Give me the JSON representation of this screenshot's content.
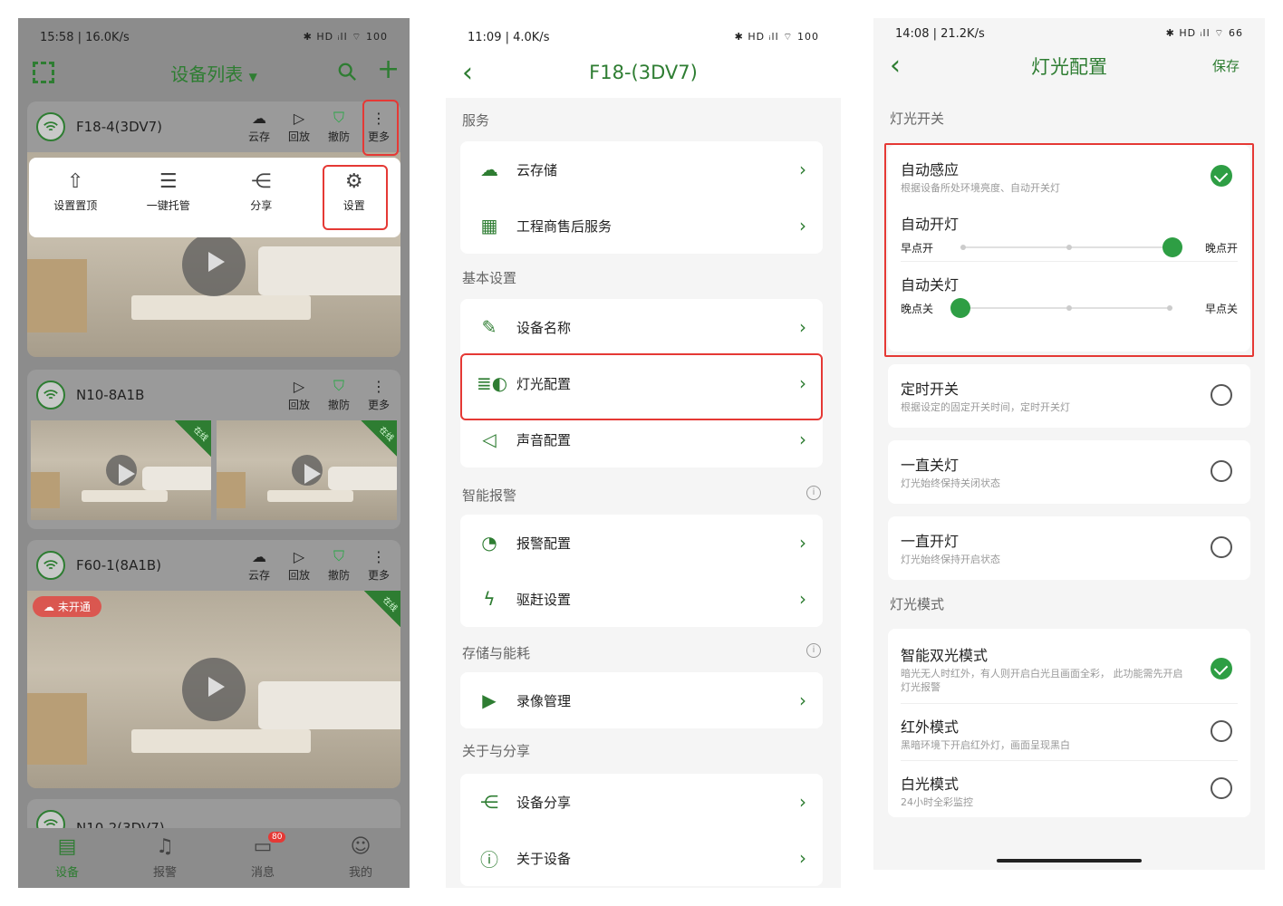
{
  "screen1": {
    "status": {
      "time": "15:58 | 16.0K/s",
      "right": "✱ HD ᵢll ⌔ 100"
    },
    "title": "设备列表",
    "devices": [
      {
        "name": "F18-4(3DV7)",
        "actions": [
          "云存",
          "回放",
          "撤防",
          "更多"
        ]
      },
      {
        "name": "N10-8A1B",
        "actions": [
          "回放",
          "撤防",
          "更多"
        ],
        "online": "在线"
      },
      {
        "name": "F60-1(8A1B)",
        "actions": [
          "云存",
          "回放",
          "撤防",
          "更多"
        ],
        "online": "在线",
        "cloud_pill": "未开通"
      },
      {
        "name": "N10-2(3DV7)"
      }
    ],
    "popup": [
      "设置置顶",
      "一键托管",
      "分享",
      "设置"
    ],
    "tabs": [
      {
        "label": "设备",
        "icon": "device-icon"
      },
      {
        "label": "报警",
        "icon": "bell-icon"
      },
      {
        "label": "消息",
        "icon": "message-icon",
        "badge": "80"
      },
      {
        "label": "我的",
        "icon": "user-icon"
      }
    ]
  },
  "screen2": {
    "status": {
      "time": "11:09 | 4.0K/s",
      "right": "✱ HD ᵢll ⌔ 100"
    },
    "title": "F18-(3DV7)",
    "sections": [
      {
        "label": "服务",
        "items": [
          "云存储",
          "工程商售后服务"
        ]
      },
      {
        "label": "基本设置",
        "items": [
          "设备名称",
          "灯光配置",
          "声音配置"
        ]
      },
      {
        "label": "智能报警",
        "items": [
          "报警配置",
          "驱赶设置"
        ]
      },
      {
        "label": "存储与能耗",
        "items": [
          "录像管理"
        ]
      },
      {
        "label": "关于与分享",
        "items": [
          "设备分享",
          "关于设备"
        ]
      }
    ]
  },
  "screen3": {
    "status": {
      "time": "14:08 | 21.2K/s",
      "right": "✱ HD ᵢll ⌔ 66"
    },
    "title": "灯光配置",
    "save": "保存",
    "section_switch": "灯光开关",
    "auto": {
      "title": "自动感应",
      "desc": "根据设备所处环境亮度、自动开关灯",
      "on_title": "自动开灯",
      "on_left": "早点开",
      "on_right": "晚点开",
      "on_level": 1.0,
      "off_title": "自动关灯",
      "off_left": "晚点关",
      "off_right": "早点关",
      "off_level": 0.0
    },
    "switch_options": [
      {
        "title": "定时开关",
        "desc": "根据设定的固定开关时间，定时开关灯"
      },
      {
        "title": "一直关灯",
        "desc": "灯光始终保持关闭状态"
      },
      {
        "title": "一直开灯",
        "desc": "灯光始终保持开启状态"
      }
    ],
    "section_mode": "灯光模式",
    "modes": [
      {
        "title": "智能双光模式",
        "desc": "暗光无人时红外，有人则开启白光且画面全彩，  此功能需先开启灯光报警",
        "selected": true
      },
      {
        "title": "红外模式",
        "desc": "黑暗环境下开启红外灯，画面呈现黑白",
        "selected": false
      },
      {
        "title": "白光模式",
        "desc": "24小时全彩监控",
        "selected": false
      }
    ]
  }
}
